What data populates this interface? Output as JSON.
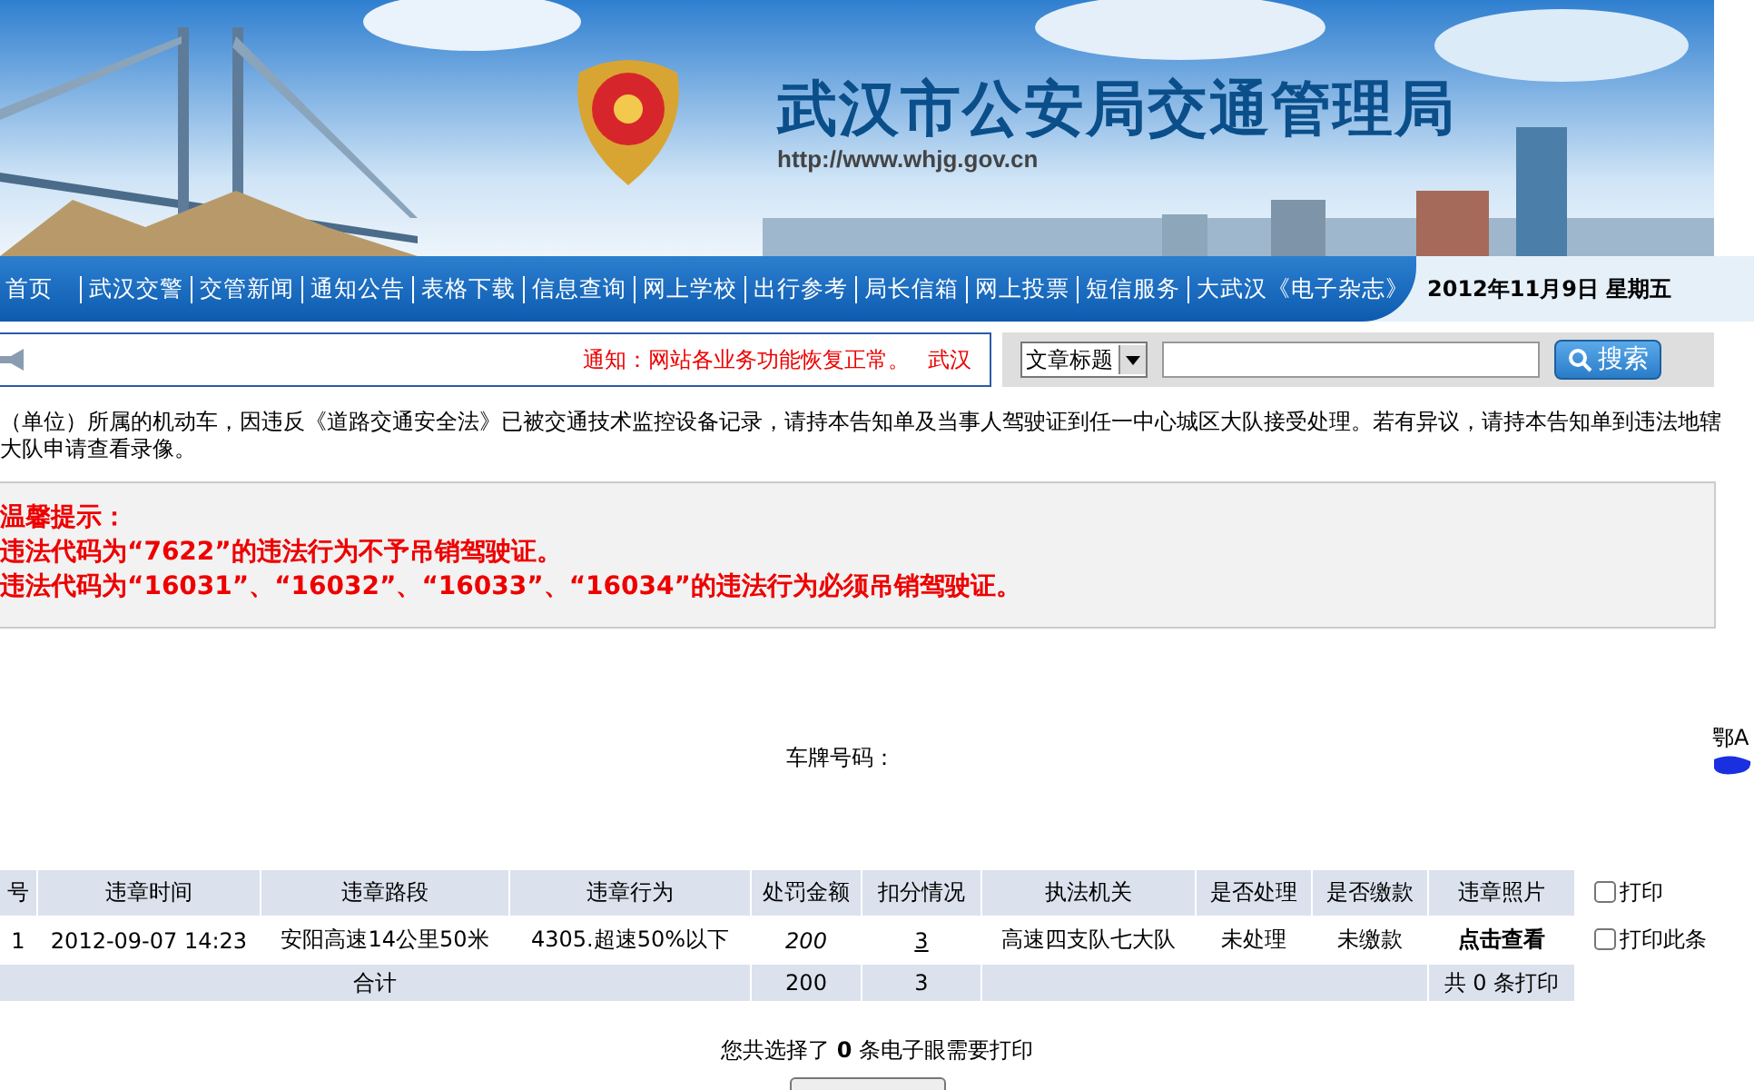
{
  "header": {
    "title": "武汉市公安局交通管理局",
    "url": "http://www.whjg.gov.cn"
  },
  "nav": {
    "items": [
      "首页",
      "武汉交警",
      "交管新闻",
      "通知公告",
      "表格下载",
      "信息查询",
      "网上学校",
      "出行参考",
      "局长信箱",
      "网上投票",
      "短信服务",
      "大武汉《电子杂志》"
    ],
    "date": "2012年11月9日  星期五"
  },
  "notice": {
    "text": "通知：网站各业务功能恢复正常。",
    "next": "武汉"
  },
  "search": {
    "category": "文章标题",
    "button": "搜索"
  },
  "intro": [
    "（单位）所属的机动车，因违反《道路交通安全法》已被交通技术监控设备记录，请持本告知单及当事人驾驶证到任一中心城区大队接受处理。若有异议，请持本告知单到违法地辖",
    "大队申请查看录像。"
  ],
  "tips": [
    "温馨提示：",
    "违法代码为“7622”的违法行为不予吊销驾驶证。",
    "违法代码为“16031”、“16032”、“16033”、“16034”的违法行为必须吊销驾驶证。"
  ],
  "plate": {
    "label": "车牌号码：",
    "value": "鄂A"
  },
  "table": {
    "columns": [
      "号",
      "违章时间",
      "违章路段",
      "违章行为",
      "处罚金额",
      "扣分情况",
      "执法机关",
      "是否处理",
      "是否缴款",
      "违章照片"
    ],
    "print_all": {
      "label": "打印",
      "checked": false
    },
    "rows": [
      {
        "number": "1",
        "time": "2012-09-07 14:23",
        "road": "安阳高速14公里50米",
        "violation": "4305.超速50%以下",
        "fine": "200",
        "points": "3",
        "authority": "高速四支队七大队",
        "processed": "未处理",
        "paid": "未缴款",
        "photo": "点击查看",
        "print": {
          "label": "打印此条",
          "checked": false
        }
      }
    ],
    "total": {
      "label": "合计",
      "fine": "200",
      "points": "3",
      "print_count": "共 0 条打印"
    }
  },
  "footer": {
    "selected": "您共选择了 **0** 条电子眼需要打印"
  }
}
